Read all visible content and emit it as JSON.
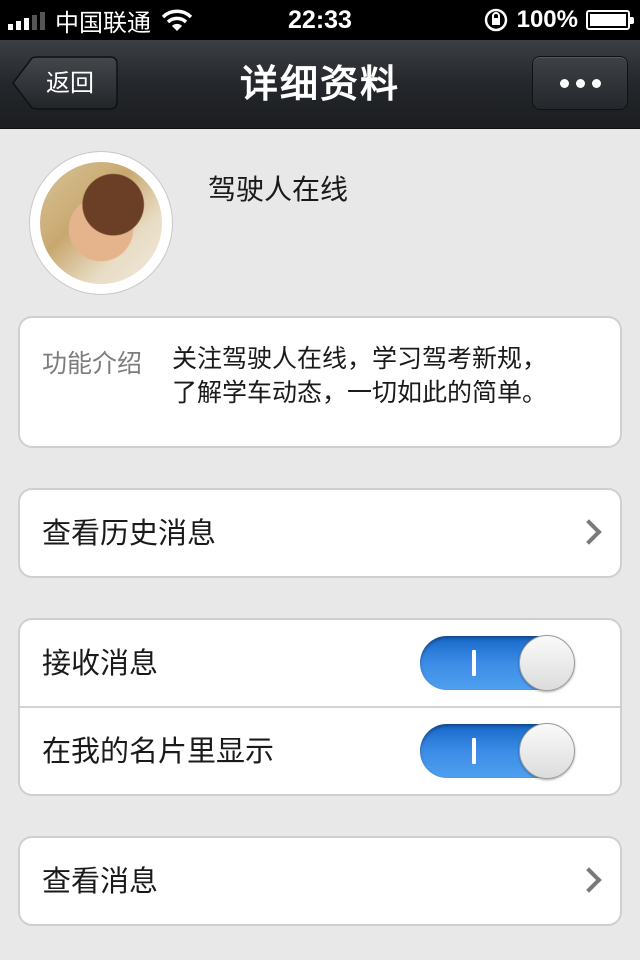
{
  "status_bar": {
    "carrier": "中国联通",
    "time": "22:33",
    "battery": "100%"
  },
  "nav": {
    "back_label": "返回",
    "title": "详细资料"
  },
  "profile": {
    "name": "驾驶人在线"
  },
  "intro": {
    "label": "功能介绍",
    "text_line1": "关注驾驶人在线，学习驾考新规，",
    "text_line2": "了解学车动态，一切如此的简单。"
  },
  "history": {
    "label": "查看历史消息"
  },
  "settings": {
    "receive_label": "接收消息",
    "receive_on": true,
    "card_label": "在我的名片里显示",
    "card_on": true
  },
  "view": {
    "label": "查看消息"
  },
  "colors": {
    "toggle_on": "#2f7ddb",
    "background": "#e8e8e8"
  }
}
